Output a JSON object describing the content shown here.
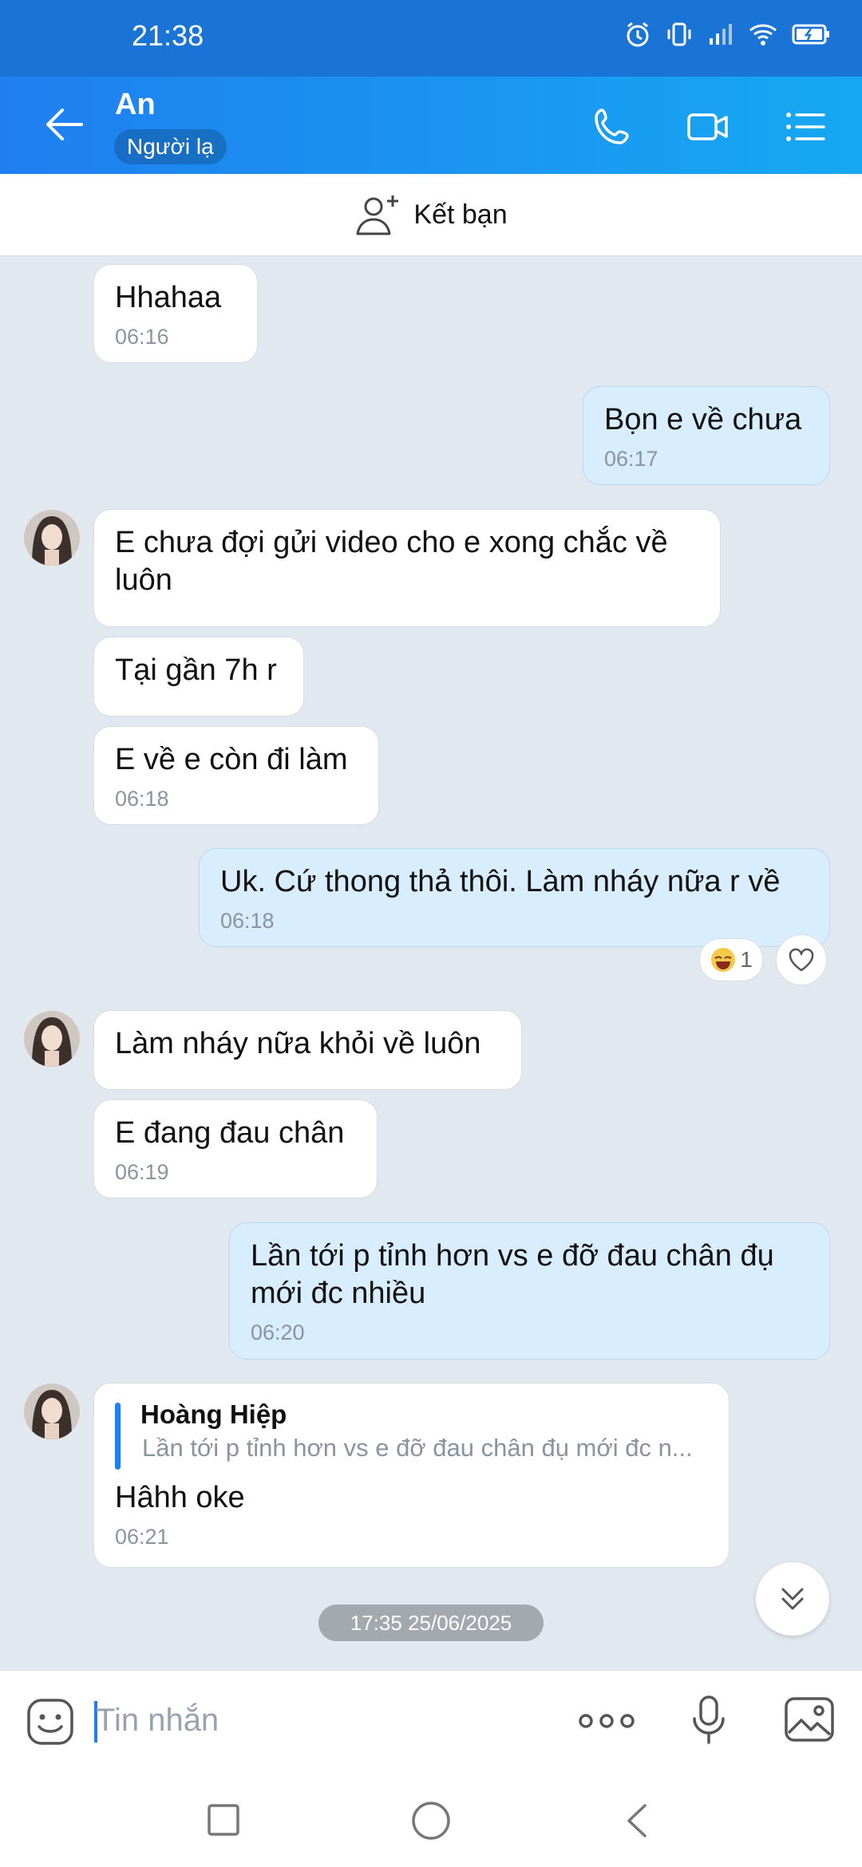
{
  "status_bar": {
    "time": "21:38"
  },
  "header": {
    "title": "An",
    "badge": "Người lạ"
  },
  "friend_bar": {
    "label": "Kết bạn"
  },
  "messages": [
    {
      "text": "Hhahaa",
      "time": "06:16"
    },
    {
      "text": "Bọn e về chưa",
      "time": "06:17"
    },
    {
      "text": "E chưa đợi gửi video cho e xong chắc về luôn"
    },
    {
      "text": "Tại gần 7h r"
    },
    {
      "text": "E về e còn đi làm",
      "time": "06:18"
    },
    {
      "text": "Uk. Cứ thong thả thôi. Làm nháy nữa r về",
      "time": "06:18"
    },
    {
      "text": "Làm nháy nữa khỏi về luôn"
    },
    {
      "text": "E đang đau chân",
      "time": "06:19"
    },
    {
      "text": "Lần tới p tỉnh hơn vs e đỡ đau chân đụ mới đc nhiều",
      "time": "06:20"
    },
    {
      "reply_name": "Hoàng Hiệp",
      "reply_text": "Lần tới p tỉnh hơn vs e đỡ đau chân đụ mới đc n...",
      "text": "Hâhh oke",
      "time": "06:21"
    }
  ],
  "reaction": {
    "count": "1"
  },
  "date_separator": "17:35 25/06/2025",
  "input": {
    "placeholder": "Tin nhắn"
  },
  "colors": {
    "header_start": "#1f7ff0",
    "header_end": "#16a8f1",
    "my_bubble": "#d8edfd",
    "chat_bg": "#e2e8f0",
    "accent": "#1f7ff0"
  }
}
